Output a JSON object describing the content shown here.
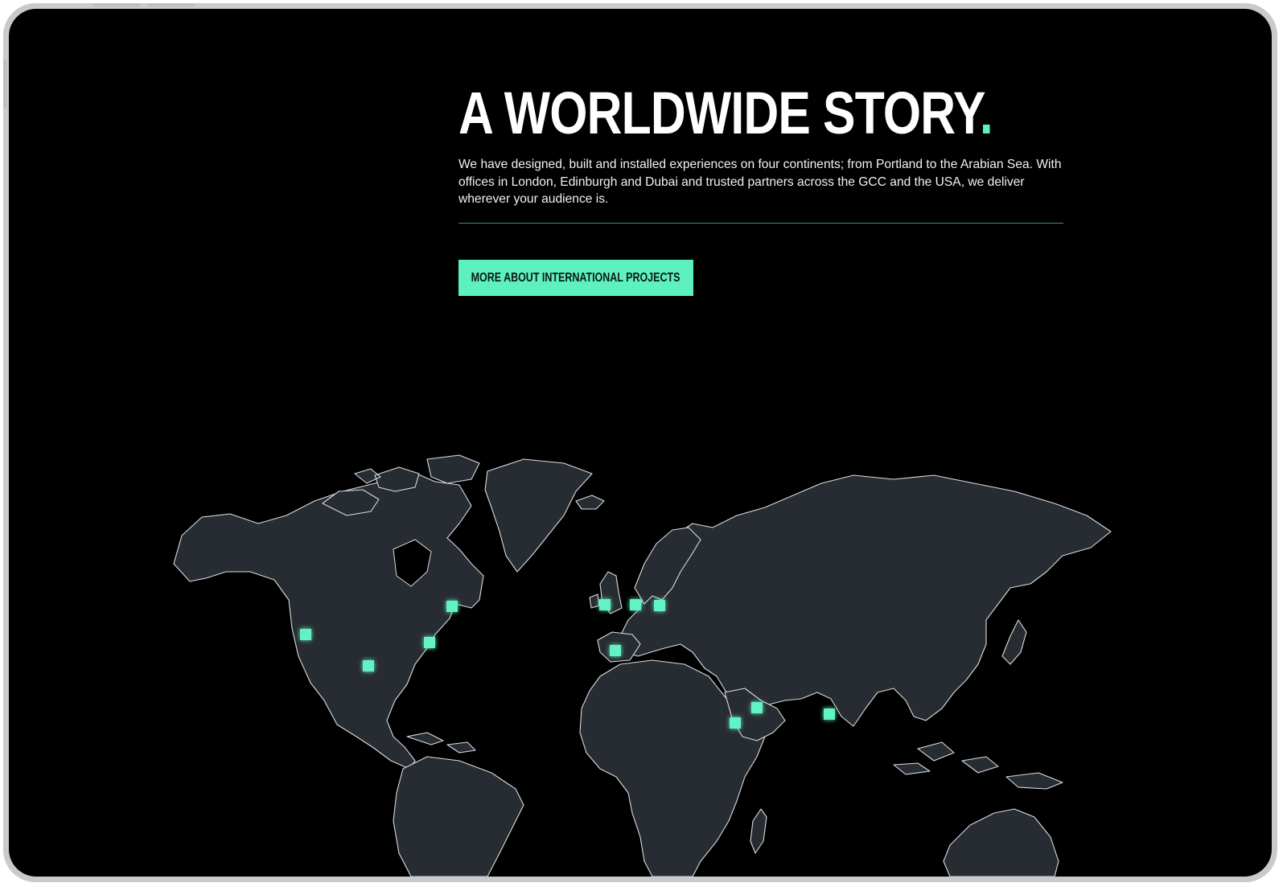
{
  "section": {
    "title_main": "A WORLDWIDE STORY",
    "title_dot": ".",
    "intro": "We have designed, built and installed experiences on four continents; from Portland to the Arabian Sea. With offices in London, Edinburgh and Dubai and trusted partners across the GCC and the USA, we deliver wherever your audience is.",
    "cta_label": "MORE ABOUT INTERNATIONAL PROJECTS"
  },
  "colors": {
    "background": "#000000",
    "accent": "#5ef0c0",
    "land": "#272c32",
    "coastline": "#d9dde0"
  }
}
